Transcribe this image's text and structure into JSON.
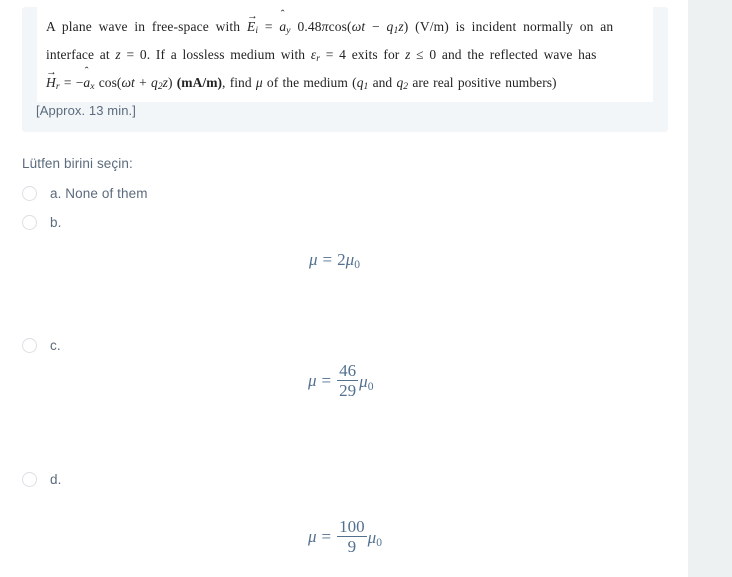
{
  "question": {
    "stem_lines": [
      "A plane wave in free-space with E⃗i = ây 0.48πcos(ωt − q1z) (V/m) is incident normally on an",
      "interface at z = 0. If a lossless medium with εr = 4 exits for z ≤ 0 and the reflected wave has",
      "H⃗r = −âx cos(ωt + q2z) (mA/m), find μ of the medium (q1 and q2 are real positive numbers)"
    ],
    "approx_time": "[Approx. 13 min.]"
  },
  "answers": {
    "prompt": "Lütfen birini seçin:",
    "options": [
      {
        "key": "a",
        "label": "a. None of them",
        "math": null
      },
      {
        "key": "b",
        "label": "b.",
        "math": {
          "lhs": "μ",
          "rel": "=",
          "coefficient": "2",
          "numerator": null,
          "denominator": null,
          "unit": "μ",
          "unit_sub": "0"
        }
      },
      {
        "key": "c",
        "label": "c.",
        "math": {
          "lhs": "μ",
          "rel": "=",
          "coefficient": null,
          "numerator": "46",
          "denominator": "29",
          "unit": "μ",
          "unit_sub": "0"
        }
      },
      {
        "key": "d",
        "label": "d.",
        "math": {
          "lhs": "μ",
          "rel": "=",
          "coefficient": null,
          "numerator": "100",
          "denominator": "9",
          "unit": "μ",
          "unit_sub": "0"
        }
      }
    ]
  },
  "colors": {
    "stem_background": "#f2f6f9",
    "text_muted": "#5b6b7c",
    "math_blue": "#52708f",
    "gutter": "#eef1f2",
    "radio_border": "#dcdfe3"
  }
}
